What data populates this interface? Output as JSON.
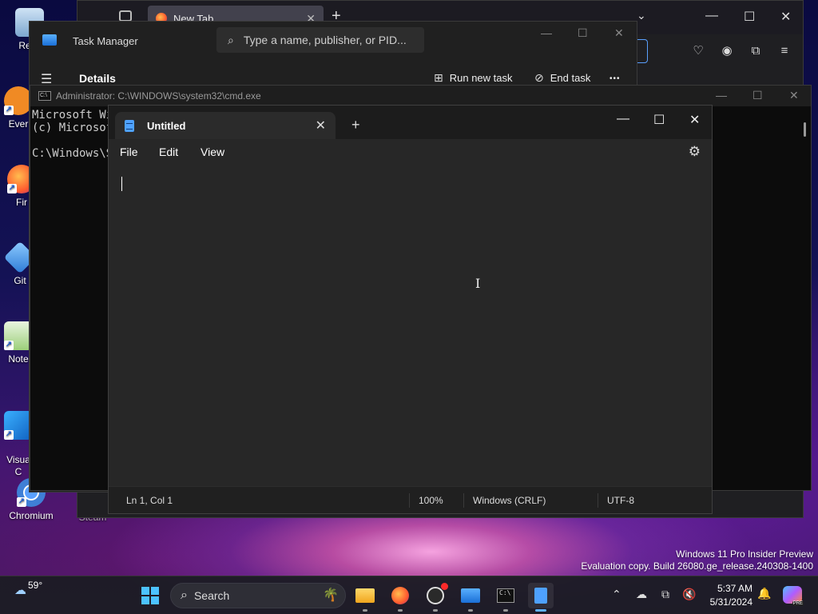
{
  "desktop": {
    "icons": [
      {
        "label": "Recy",
        "icon": "recycle-bin-icon"
      },
      {
        "label": "Ever",
        "icon": "everything-icon"
      },
      {
        "label": "Fir",
        "icon": "firefox-icon"
      },
      {
        "label": "Git",
        "icon": "git-icon"
      },
      {
        "label": "Note",
        "icon": "notepad-plus-icon"
      },
      {
        "label": "Visua\nC",
        "icon": "vscode-icon"
      },
      {
        "label": "Chromium",
        "icon": "chromium-icon"
      },
      {
        "label": "Steam",
        "icon": "steam-icon"
      }
    ]
  },
  "browser": {
    "tab_title": "New Tab",
    "tab_close": "✕",
    "new_tab": "+",
    "tab_list": "⌄",
    "minimize": "—",
    "maximize": "☐",
    "close": "✕"
  },
  "taskmgr": {
    "title": "Task Manager",
    "search_placeholder": "Type a name, publisher, or PID...",
    "page": "Details",
    "run_new_task": "Run new task",
    "end_task": "End task",
    "more": "•••",
    "minimize": "—",
    "maximize": "☐",
    "close": "✕"
  },
  "cmd": {
    "title": "Administrator: C:\\WINDOWS\\system32\\cmd.exe",
    "lines": [
      "Microsoft Wi",
      "(c) Microsof",
      "",
      "C:\\Windows\\S"
    ],
    "minimize": "—",
    "maximize": "☐",
    "close": "✕"
  },
  "notepad": {
    "tab_title": "Untitled",
    "tab_close": "✕",
    "new_tab": "+",
    "menu": [
      "File",
      "Edit",
      "View"
    ],
    "minimize": "—",
    "maximize": "☐",
    "close": "✕",
    "content": "",
    "status": {
      "position": "Ln 1, Col 1",
      "zoom": "100%",
      "line_endings": "Windows (CRLF)",
      "encoding": "UTF-8"
    }
  },
  "watermark": {
    "line1": "Windows 11 Pro Insider Preview",
    "line2": "Evaluation copy. Build 26080.ge_release.240308-1400"
  },
  "taskbar": {
    "weather": "59°",
    "search_label": "Search",
    "apps": [
      "file-explorer",
      "firefox",
      "obs",
      "task-manager",
      "terminal",
      "notepad"
    ],
    "clock_time": "5:37 AM",
    "clock_date": "5/31/2024",
    "copilot_badge": "PRE"
  },
  "colors": {
    "accent": "#4ea1ff",
    "notepad_bg": "#272727",
    "cmd_bg": "#0c0c0c"
  }
}
